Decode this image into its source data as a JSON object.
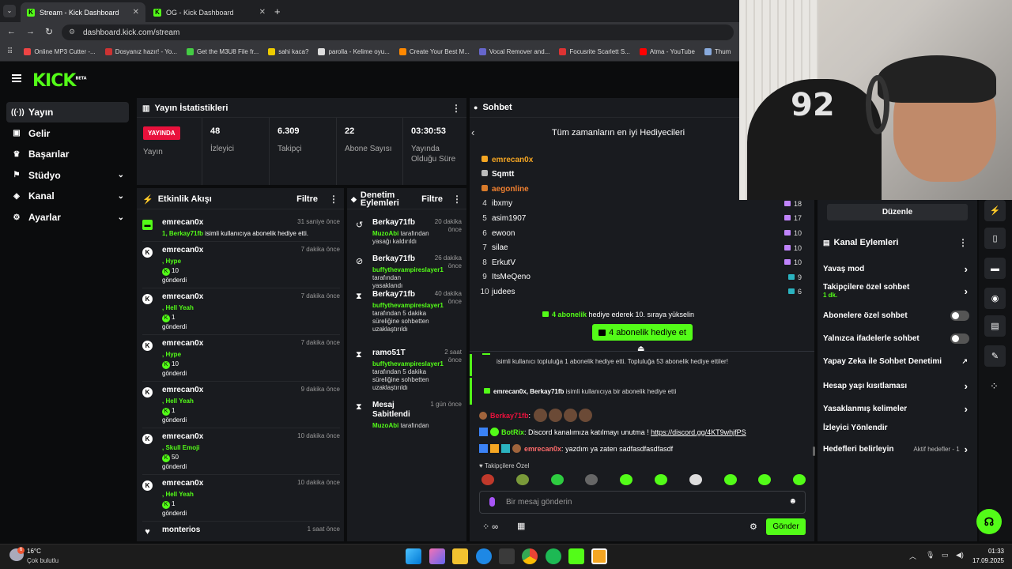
{
  "browser": {
    "tabs": [
      {
        "title": "Stream - Kick Dashboard"
      },
      {
        "title": "OG - Kick Dashboard"
      }
    ],
    "url": "dashboard.kick.com/stream",
    "bookmarks": [
      {
        "label": "Online MP3 Cutter -...",
        "color": "#e44"
      },
      {
        "label": "Dosyanız hazır! - Yo...",
        "color": "#c33"
      },
      {
        "label": "Get the M3U8 File fr...",
        "color": "#4c4"
      },
      {
        "label": "sahi kaca?",
        "color": "#ec0"
      },
      {
        "label": "parolla - Kelime oyu...",
        "color": "#ddd"
      },
      {
        "label": "Create Your Best M...",
        "color": "#f80"
      },
      {
        "label": "Vocal Remover and...",
        "color": "#66c"
      },
      {
        "label": "Focusrite Scarlett S...",
        "color": "#d33"
      },
      {
        "label": "Atma - YouTube",
        "color": "#f00"
      },
      {
        "label": "Thum",
        "color": "#8ad"
      }
    ]
  },
  "brand": {
    "logo": "KICK",
    "beta": "BETA",
    "accent": "#53fc18"
  },
  "sidebar": [
    {
      "label": "Yayın",
      "icon": "broadcast-icon"
    },
    {
      "label": "Gelir",
      "icon": "wallet-icon"
    },
    {
      "label": "Başarılar",
      "icon": "trophy-icon"
    },
    {
      "label": "Stüdyo",
      "icon": "studio-icon"
    },
    {
      "label": "Kanal",
      "icon": "channel-icon"
    },
    {
      "label": "Ayarlar",
      "icon": "gear-icon"
    }
  ],
  "stats": {
    "title": "Yayın İstatistikleri",
    "live_badge": "YAYINDA",
    "live_label": "Yayın",
    "items": [
      {
        "value": "48",
        "label": "İzleyici"
      },
      {
        "value": "6.309",
        "label": "Takipçi"
      },
      {
        "value": "22",
        "label": "Abone Sayısı"
      },
      {
        "value": "03:30:53",
        "label": "Yayında Olduğu Süre"
      }
    ]
  },
  "events": {
    "title": "Etkinlik Akışı",
    "filter": "Filtre",
    "items": [
      {
        "user": "emrecan0x",
        "time": "31 saniye önce",
        "line1": "1, Berkay71fb",
        "line2": "isimli kullanıcıya abonelik hediye etti."
      },
      {
        "user": "emrecan0x",
        "time": "7 dakika önce",
        "item": "Hype",
        "amount": "10",
        "sent": "gönderdi"
      },
      {
        "user": "emrecan0x",
        "time": "7 dakika önce",
        "item": "Hell Yeah",
        "amount": "1",
        "sent": "gönderdi"
      },
      {
        "user": "emrecan0x",
        "time": "7 dakika önce",
        "item": "Hype",
        "amount": "10",
        "sent": "gönderdi"
      },
      {
        "user": "emrecan0x",
        "time": "9 dakika önce",
        "item": "Hell Yeah",
        "amount": "1",
        "sent": "gönderdi"
      },
      {
        "user": "emrecan0x",
        "time": "10 dakika önce",
        "item": "Skull Emoji",
        "amount": "50",
        "sent": "gönderdi"
      },
      {
        "user": "emrecan0x",
        "time": "10 dakika önce",
        "item": "Hell Yeah",
        "amount": "1",
        "sent": "gönderdi"
      },
      {
        "user": "monterios",
        "time": "1 saat önce"
      }
    ]
  },
  "mod": {
    "title": "Denetim Eylemleri",
    "filter": "Filtre",
    "items": [
      {
        "user": "Berkay71fb",
        "time": "20 dakika önce",
        "by": "MuzoAbi",
        "text": "tarafından yasağı kaldırıldı"
      },
      {
        "user": "Berkay71fb",
        "time": "26 dakika önce",
        "by": "buffythevampireslayer1",
        "text": "tarafından yasaklandı"
      },
      {
        "user": "Berkay71fb",
        "time": "40 dakika önce",
        "by": "buffythevampireslayer1",
        "text": "tarafından 5 dakika süreliğine sohbetten uzaklaştırıldı"
      },
      {
        "user": "ramo51T",
        "time": "2 saat önce",
        "by": "buffythevampireslayer1",
        "text": "tarafından 5 dakika süreliğine sohbetten uzaklaştırıldı"
      },
      {
        "user": "Mesaj Sabitlendi",
        "time": "1 gün önce",
        "by": "MuzoAbi",
        "text": "tarafından"
      }
    ]
  },
  "chat": {
    "title": "Sohbet",
    "lb_title": "Tüm zamanların en iyi Hediyecileri",
    "leaders": [
      {
        "rank": "",
        "name": "emrecan0x",
        "count": ""
      },
      {
        "rank": "",
        "name": "Sqmtt",
        "count": ""
      },
      {
        "rank": "",
        "name": "aegonline",
        "count": ""
      },
      {
        "rank": "4",
        "name": "ibxmy",
        "count": "18"
      },
      {
        "rank": "5",
        "name": "asim1907",
        "count": "17"
      },
      {
        "rank": "6",
        "name": "ewoon",
        "count": "10"
      },
      {
        "rank": "7",
        "name": "silae",
        "count": "10"
      },
      {
        "rank": "8",
        "name": "ErkutV",
        "count": "10"
      },
      {
        "rank": "9",
        "name": "ItsMeQeno",
        "count": "9"
      },
      {
        "rank": "10",
        "name": "judees",
        "count": "6"
      }
    ],
    "promo_bold": "4 abonelik",
    "promo_rest": "hediye ederek 10. sıraya yükselin",
    "gift_button": "4 abonelik hediye et",
    "sys1": "isimli kullanıcı topluluğa 1 abonelik hediye etti. Topluluğa 53 abonelik hediye ettiler!",
    "sys2_names": "emrecan0x, Berkay71fb",
    "sys2_rest": "isimli kullanıcıya bir abonelik hediye etti",
    "m1_user": "Berkay71fb",
    "m2_user": "BotRix",
    "m2_text": "Discord kanalımıza katılmayı unutma !",
    "m2_link": "https://discord.gg/4KT9whjfPS",
    "m3_user": "emrecan0x",
    "m3_text": "yazdım ya zaten sadfasdfasdfasdf",
    "followers_only": "Takipçilere Özel",
    "placeholder": "Bir mesaj gönderin",
    "send": "Gönder"
  },
  "actions": {
    "edit": "Düzenle",
    "title": "Kanal Eylemleri",
    "items": [
      {
        "label": "Yavaş mod",
        "type": "chevron"
      },
      {
        "label": "Takipçilere özel sohbet",
        "sub": "1 dk.",
        "type": "chevron"
      },
      {
        "label": "Abonelere özel sohbet",
        "type": "toggle"
      },
      {
        "label": "Yalnızca ifadelerle sohbet",
        "type": "toggle"
      },
      {
        "label": "Yapay Zeka ile Sohbet Denetimi",
        "type": "external"
      },
      {
        "label": "Hesap yaşı kısıtlaması",
        "type": "chevron"
      },
      {
        "label": "Yasaklanmış kelimeler",
        "type": "chevron"
      },
      {
        "label": "İzleyici Yönlendir",
        "type": "none"
      },
      {
        "label": "Hedefleri belirleyin",
        "status": "Aktif hedefler - 1",
        "type": "chevron"
      }
    ]
  },
  "taskbar": {
    "temp": "16°C",
    "weather": "Çok bulutlu",
    "time": "01:33",
    "date": "17.09.2025",
    "badge": "6"
  }
}
